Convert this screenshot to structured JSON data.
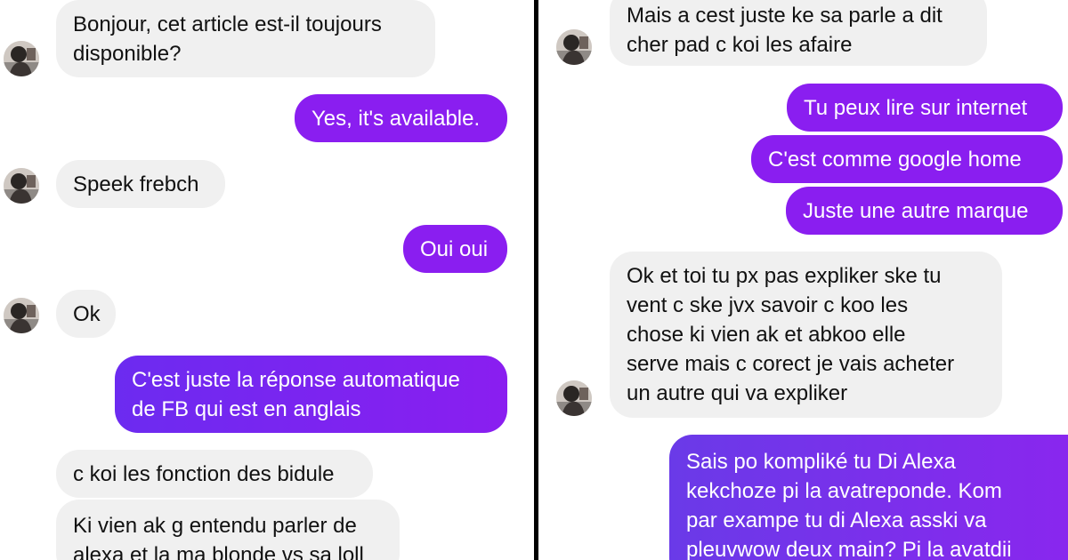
{
  "left_conversation": {
    "messages": [
      {
        "sender": "contact",
        "text": "Bonjour, cet article est-il toujours\ndisponible?"
      },
      {
        "sender": "me",
        "text": "Yes, it's available."
      },
      {
        "sender": "contact",
        "text": "Speek frebch"
      },
      {
        "sender": "me",
        "text": "Oui oui"
      },
      {
        "sender": "contact",
        "text": "Ok"
      },
      {
        "sender": "me",
        "text": "C'est juste la réponse automatique\nde FB qui est en anglais"
      },
      {
        "sender": "contact",
        "text": "c koi les fonction des bidule"
      },
      {
        "sender": "contact",
        "text": "Ki vien ak g entendu parler de\nalexa et la ma blonde vs sa loll"
      }
    ]
  },
  "right_conversation": {
    "messages": [
      {
        "sender": "contact",
        "text": "Mais a cest juste ke sa parle a dit\ncher pad c koi les afaire"
      },
      {
        "sender": "me",
        "text": "Tu peux lire sur internet"
      },
      {
        "sender": "me",
        "text": "C'est comme google home"
      },
      {
        "sender": "me",
        "text": "Juste une autre marque"
      },
      {
        "sender": "contact",
        "text": "Ok et toi tu px pas expliker ske tu\nvent c ske jvx savoir c koo les\nchose ki vien ak et abkoo elle\nserve mais c corect je vais acheter\nun autre qui va expliker"
      },
      {
        "sender": "me",
        "text": "Sais po kompliké tu Di Alexa\nkekchoze pi la avatreponde. Kom\npar exampe tu di Alexa asski va\npleuvwow deux main? Pi la avatdii"
      }
    ]
  },
  "colors": {
    "outgoing_bubble": "#8a1ef0",
    "outgoing_bubble_gradient_start": "#6c2bf0",
    "incoming_bubble": "#f0f0f0",
    "divider": "#000000"
  },
  "icons": {
    "contact_avatar": "avatar-photo"
  }
}
